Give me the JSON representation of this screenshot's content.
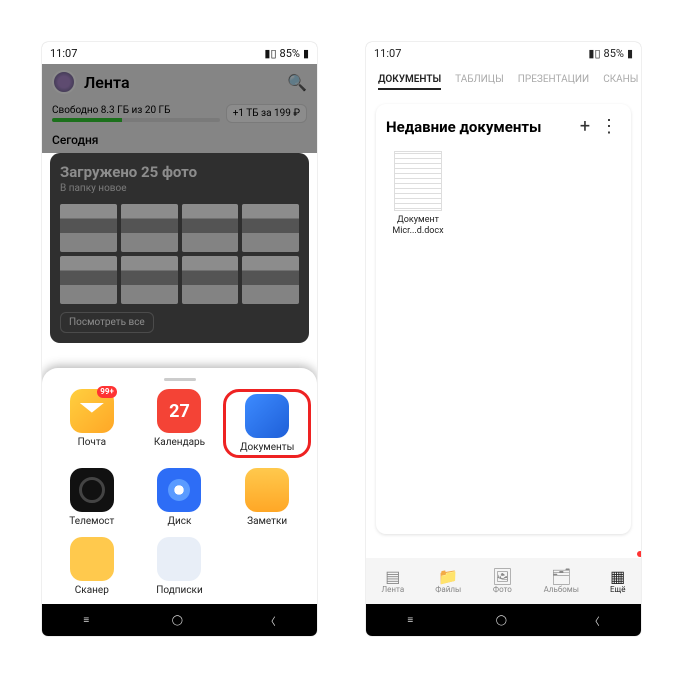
{
  "status": {
    "time": "11:07",
    "battery": "85%"
  },
  "left": {
    "header_title": "Лента",
    "storage_text": "Свободно 8.3 ГБ из 20 ГБ",
    "bonus": "+1 ТБ за 199 ₽",
    "today": "Сегодня",
    "upload_title": "Загружено 25 фото",
    "upload_sub": "В папку новое",
    "view_all": "Посмотреть все",
    "apps": [
      {
        "label": "Почта",
        "icon": "mail",
        "badge": "99+"
      },
      {
        "label": "Календарь",
        "icon": "cal",
        "text": "27"
      },
      {
        "label": "Документы",
        "icon": "doc",
        "highlighted": true
      },
      {
        "label": "Телемост",
        "icon": "tele"
      },
      {
        "label": "Диск",
        "icon": "disk"
      },
      {
        "label": "Заметки",
        "icon": "notes"
      },
      {
        "label": "Сканер",
        "icon": "scan"
      },
      {
        "label": "Подписки",
        "icon": "subs"
      }
    ]
  },
  "right": {
    "tabs": [
      "ДОКУМЕНТЫ",
      "ТАБЛИЦЫ",
      "ПРЕЗЕНТАЦИИ",
      "СКАНЫ"
    ],
    "recent_title": "Недавние документы",
    "doc": {
      "line1": "Документ",
      "line2": "Micr...d.docx"
    },
    "bottom": [
      "Лента",
      "Файлы",
      "Фото",
      "Альбомы",
      "Ещё"
    ]
  }
}
